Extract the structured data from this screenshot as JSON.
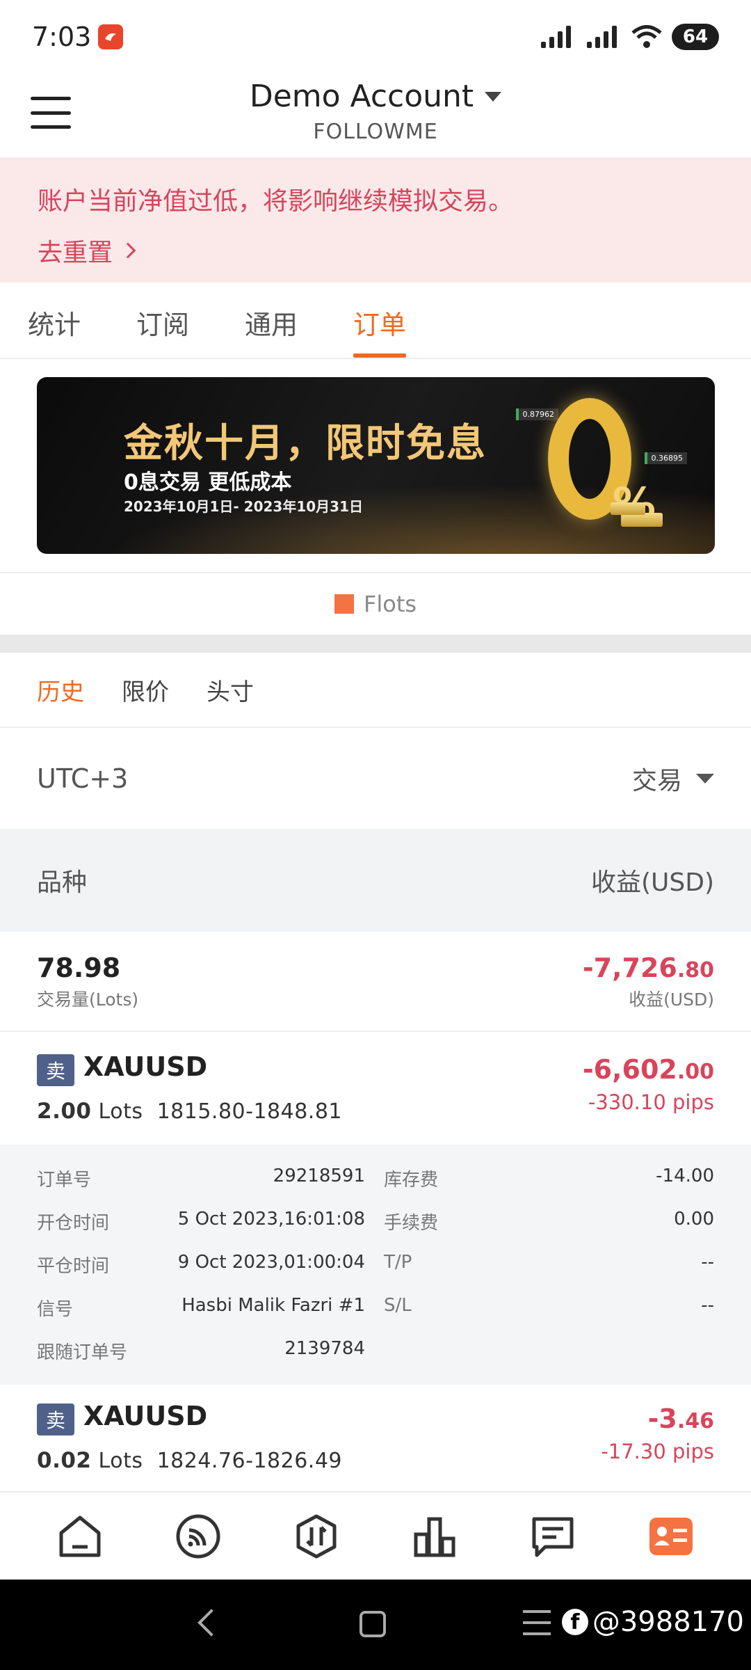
{
  "status_bar": {
    "time": "7:03",
    "battery": "64"
  },
  "header": {
    "account_title": "Demo Account",
    "account_subtitle": "FOLLOWME"
  },
  "warning": {
    "text": "账户当前净值过低，将影响继续模拟交易。",
    "link_label": "去重置"
  },
  "main_tabs": [
    {
      "label": "统计"
    },
    {
      "label": "订阅"
    },
    {
      "label": "通用"
    },
    {
      "label": "订单"
    }
  ],
  "banner": {
    "title": "金秋十月，限时免息",
    "subtitle": "0息交易 更低成本",
    "date_range": "2023年10月1日- 2023年10月31日",
    "percent": "%",
    "tag1": "0.87962",
    "tag2": "0.36895"
  },
  "legend": {
    "label": "Flots",
    "color": "#f57243"
  },
  "sub_tabs": [
    {
      "label": "历史"
    },
    {
      "label": "限价"
    },
    {
      "label": "头寸"
    }
  ],
  "filter": {
    "timezone": "UTC+3",
    "trade_label": "交易"
  },
  "table_header": {
    "left": "品种",
    "right": "收益(USD)"
  },
  "summary": {
    "volume": "78.98",
    "volume_caption": "交易量(Lots)",
    "profit_main": "-7,726",
    "profit_decimal": ".80",
    "profit_caption": "收益(USD)"
  },
  "orders": [
    {
      "side": "卖",
      "symbol": "XAUUSD",
      "lots_value": "2.00",
      "lots_unit": "Lots",
      "price_range": "1815.80-1848.81",
      "profit_main": "-6,602",
      "profit_decimal": ".00",
      "pips": "-330.10 pips",
      "details": {
        "order_no_label": "订单号",
        "order_no": "29218591",
        "swap_label": "库存费",
        "swap": "-14.00",
        "open_time_label": "开仓时间",
        "open_time": "5 Oct 2023,16:01:08",
        "fee_label": "手续费",
        "fee": "0.00",
        "close_time_label": "平仓时间",
        "close_time": "9 Oct 2023,01:00:04",
        "tp_label": "T/P",
        "tp": "--",
        "signal_label": "信号",
        "signal": "Hasbi Malik Fazri #1",
        "sl_label": "S/L",
        "sl": "--",
        "follow_label": "跟随订单号",
        "follow_no": "2139784"
      }
    },
    {
      "side": "卖",
      "symbol": "XAUUSD",
      "lots_value": "0.02",
      "lots_unit": "Lots",
      "price_range": "1824.76-1826.49",
      "profit_main": "-3",
      "profit_decimal": ".46",
      "pips": "-17.30 pips"
    }
  ],
  "bottom_nav": [
    {
      "icon": "home-icon"
    },
    {
      "icon": "signal-icon"
    },
    {
      "icon": "trade-icon"
    },
    {
      "icon": "chart-icon"
    },
    {
      "icon": "message-icon"
    },
    {
      "icon": "profile-card-icon"
    }
  ],
  "watermark": {
    "text": "@3988170"
  },
  "colors": {
    "accent": "#f06a23",
    "negative": "#d9445b",
    "sell_badge": "#4f6189",
    "warning_bg": "#fbe9ea"
  }
}
